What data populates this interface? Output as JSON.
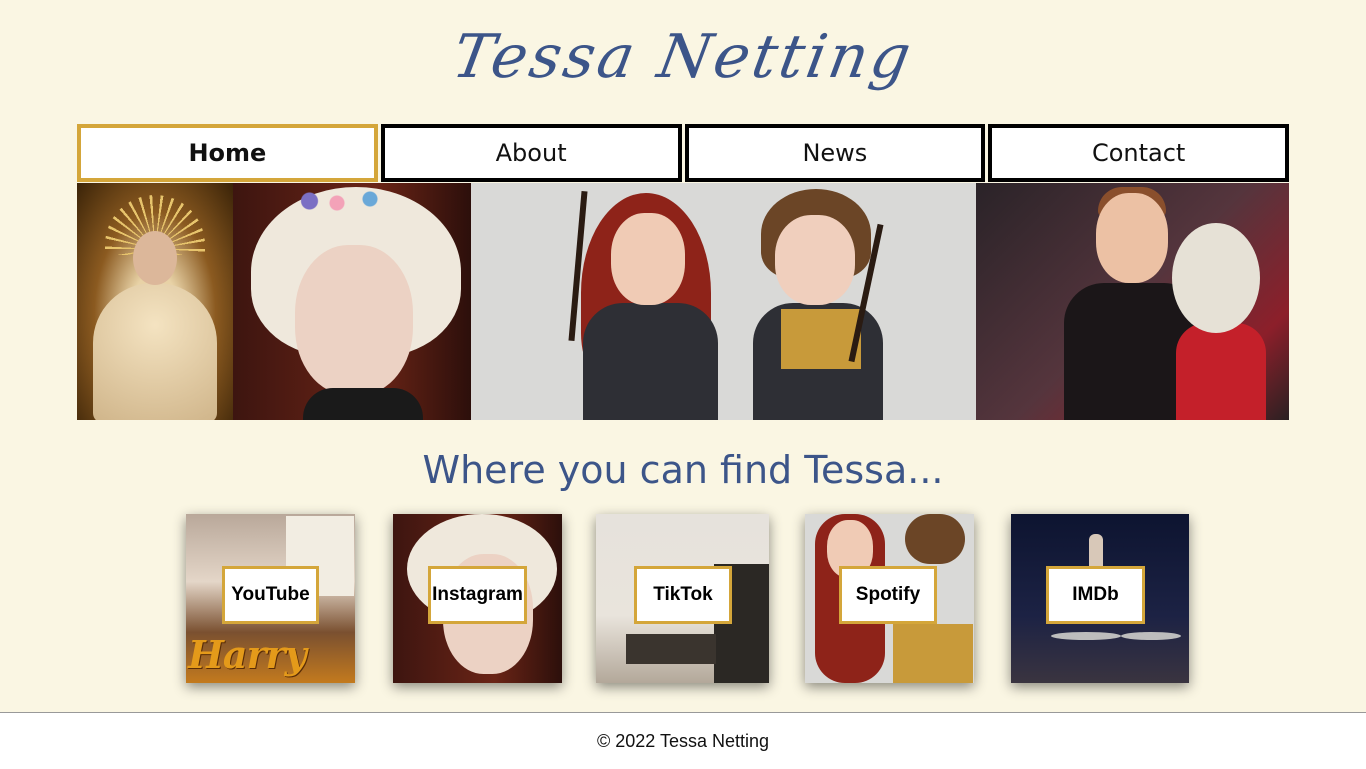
{
  "site": {
    "title": "Tessa Netting"
  },
  "nav": {
    "items": [
      {
        "label": "Home",
        "active": true
      },
      {
        "label": "About",
        "active": false
      },
      {
        "label": "News",
        "active": false
      },
      {
        "label": "Contact",
        "active": false
      }
    ]
  },
  "main": {
    "heading": "Where you can find Tessa...",
    "cards": [
      {
        "label": "YouTube",
        "image_text": "Harry Potter"
      },
      {
        "label": "Instagram"
      },
      {
        "label": "TikTok"
      },
      {
        "label": "Spotify"
      },
      {
        "label": "IMDb"
      }
    ]
  },
  "footer": {
    "text": "© 2022 Tessa Netting"
  },
  "colors": {
    "background": "#faf6e3",
    "accent": "#3c5589",
    "active_border": "#d4a63a"
  }
}
